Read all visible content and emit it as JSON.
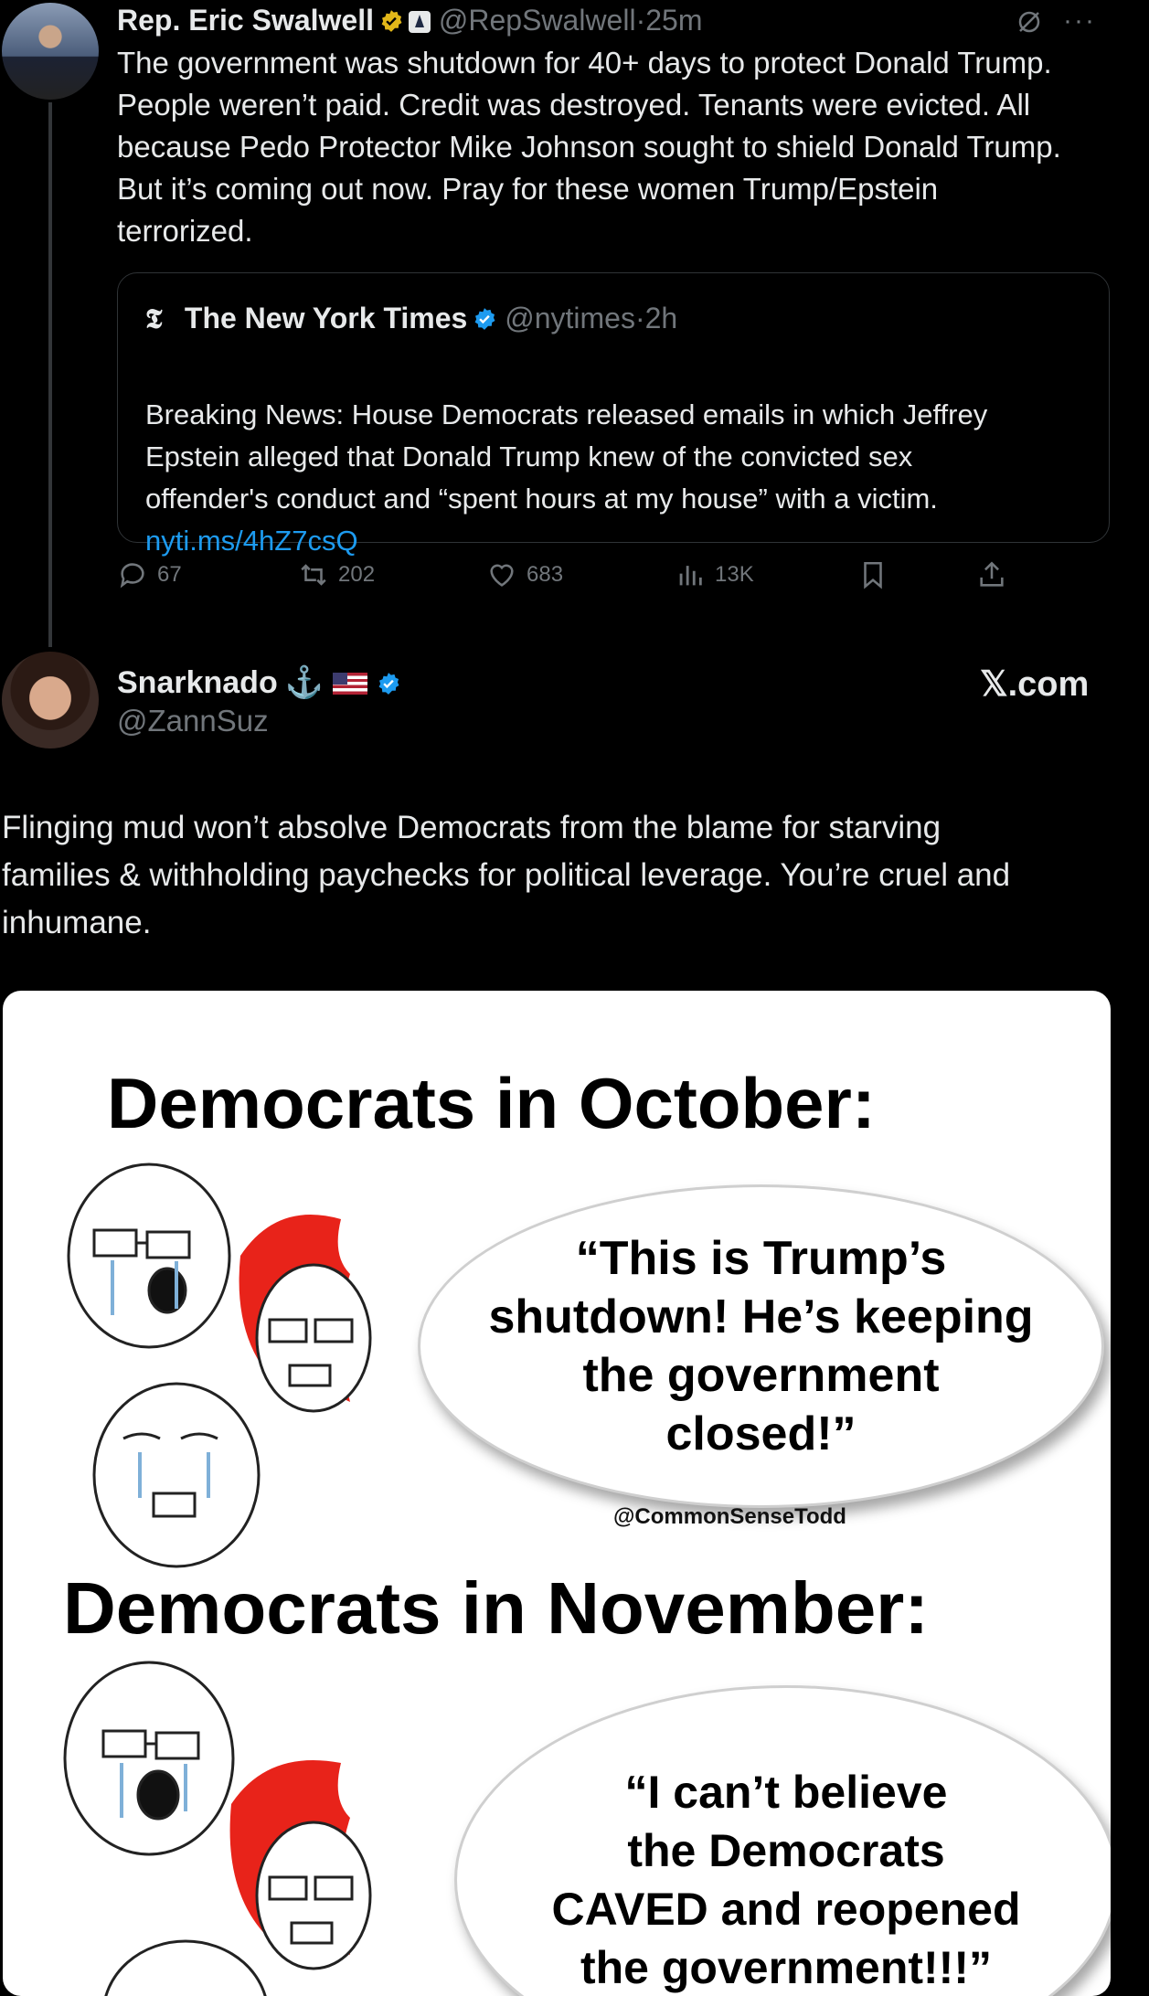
{
  "tweet1": {
    "author_name": "Rep. Eric Swalwell",
    "handle": "@RepSwalwell",
    "separator": "·",
    "time": "25m",
    "body": "The government was shutdown for 40+ days to protect Donald Trump.\nPeople weren’t paid.  Credit was destroyed.  Tenants were evicted.  All\nbecause Pedo Protector Mike Johnson sought to shield Donald Trump.\nBut it’s coming out now.  Pray for these women Trump/Epstein\nterrorized.",
    "top_icons": [
      "grok-icon",
      "more-icon"
    ],
    "quote": {
      "author_name": "The New York Times",
      "logo": "𝕿",
      "handle": "@nytimes",
      "separator": "·",
      "time": "2h",
      "body": "Breaking News: House Democrats released emails in which Jeffrey\nEpstein alleged that Donald Trump knew of the convicted sex\noffender's conduct and “spent hours at my house” with a victim.",
      "link": "nyti.ms/4hZ7csQ"
    },
    "actions": {
      "replies": "67",
      "reposts": "202",
      "likes": "683",
      "views": "13K"
    }
  },
  "tweet2": {
    "author_name": "Snarknado",
    "anchor": "⚓",
    "handle": "@ZannSuz",
    "watermark": "𝕏.com",
    "body": "Flinging mud won’t absolve Democrats from the blame for starving\nfamilies & withholding paychecks for political leverage. You’re cruel and\ninhumane."
  },
  "meme": {
    "title1": "Democrats in October:",
    "bubble1": "“This is Trump’s\nshutdown! He’s keeping\nthe government\nclosed!”",
    "credit": "@CommonSenseTodd",
    "title2": "Democrats in November:",
    "bubble2": "“I can’t believe\nthe Democrats\nCAVED and reopened\nthe government!!!”"
  },
  "colors": {
    "background": "#000000",
    "text": "#e7e9ea",
    "muted": "#71767b",
    "link": "#1d9bf0",
    "verified": "#1d9bf0",
    "gold_badge": "#e2b719",
    "meme_red_hair": "#e8231a"
  }
}
